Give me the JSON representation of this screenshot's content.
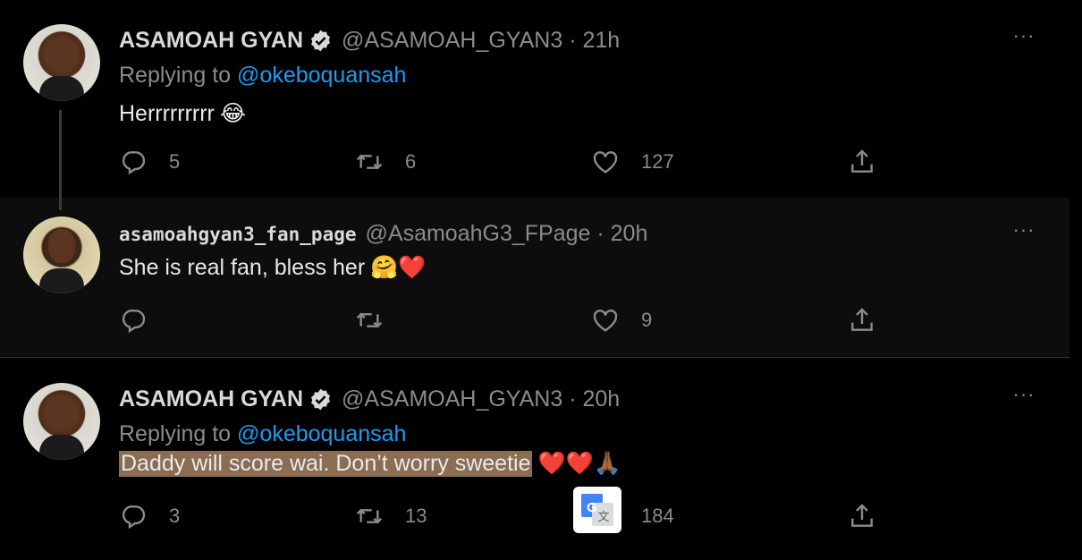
{
  "tweets": [
    {
      "name": "ASAMOAH GYAN",
      "verified": true,
      "handle": "@ASAMOAH_GYAN3 · 21h",
      "replying_prefix": "Replying to",
      "replying_to": "@okeboquansah",
      "text": "Herrrrrrrrr",
      "emoji": "😂",
      "replies": "5",
      "retweets": "6",
      "likes": "127"
    },
    {
      "name": "asamoahgyan3_fan_page",
      "verified": false,
      "handle": "@AsamoahG3_FPage · 20h",
      "text": "She is real fan, bless her",
      "emoji": "🤗❤️",
      "replies": "",
      "retweets": "",
      "likes": "9"
    },
    {
      "name": "ASAMOAH GYAN",
      "verified": true,
      "handle": "@ASAMOAH_GYAN3 · 20h",
      "replying_prefix": "Replying to",
      "replying_to": "@okeboquansah",
      "text": "Daddy will score wai. Don’t worry sweetie",
      "emoji": "❤️❤️🙏🏾",
      "replies": "3",
      "retweets": "13",
      "likes": "184"
    }
  ],
  "more_icon": "···",
  "colors": {
    "background": "#000000",
    "text": "#e7e9ea",
    "secondary": "#8b8b8b",
    "link": "#1d9bf0",
    "highlight": "#8a6d52"
  },
  "icons": [
    "reply-icon",
    "retweet-icon",
    "like-icon",
    "share-icon",
    "verified-icon",
    "more-icon",
    "google-translate-icon"
  ]
}
